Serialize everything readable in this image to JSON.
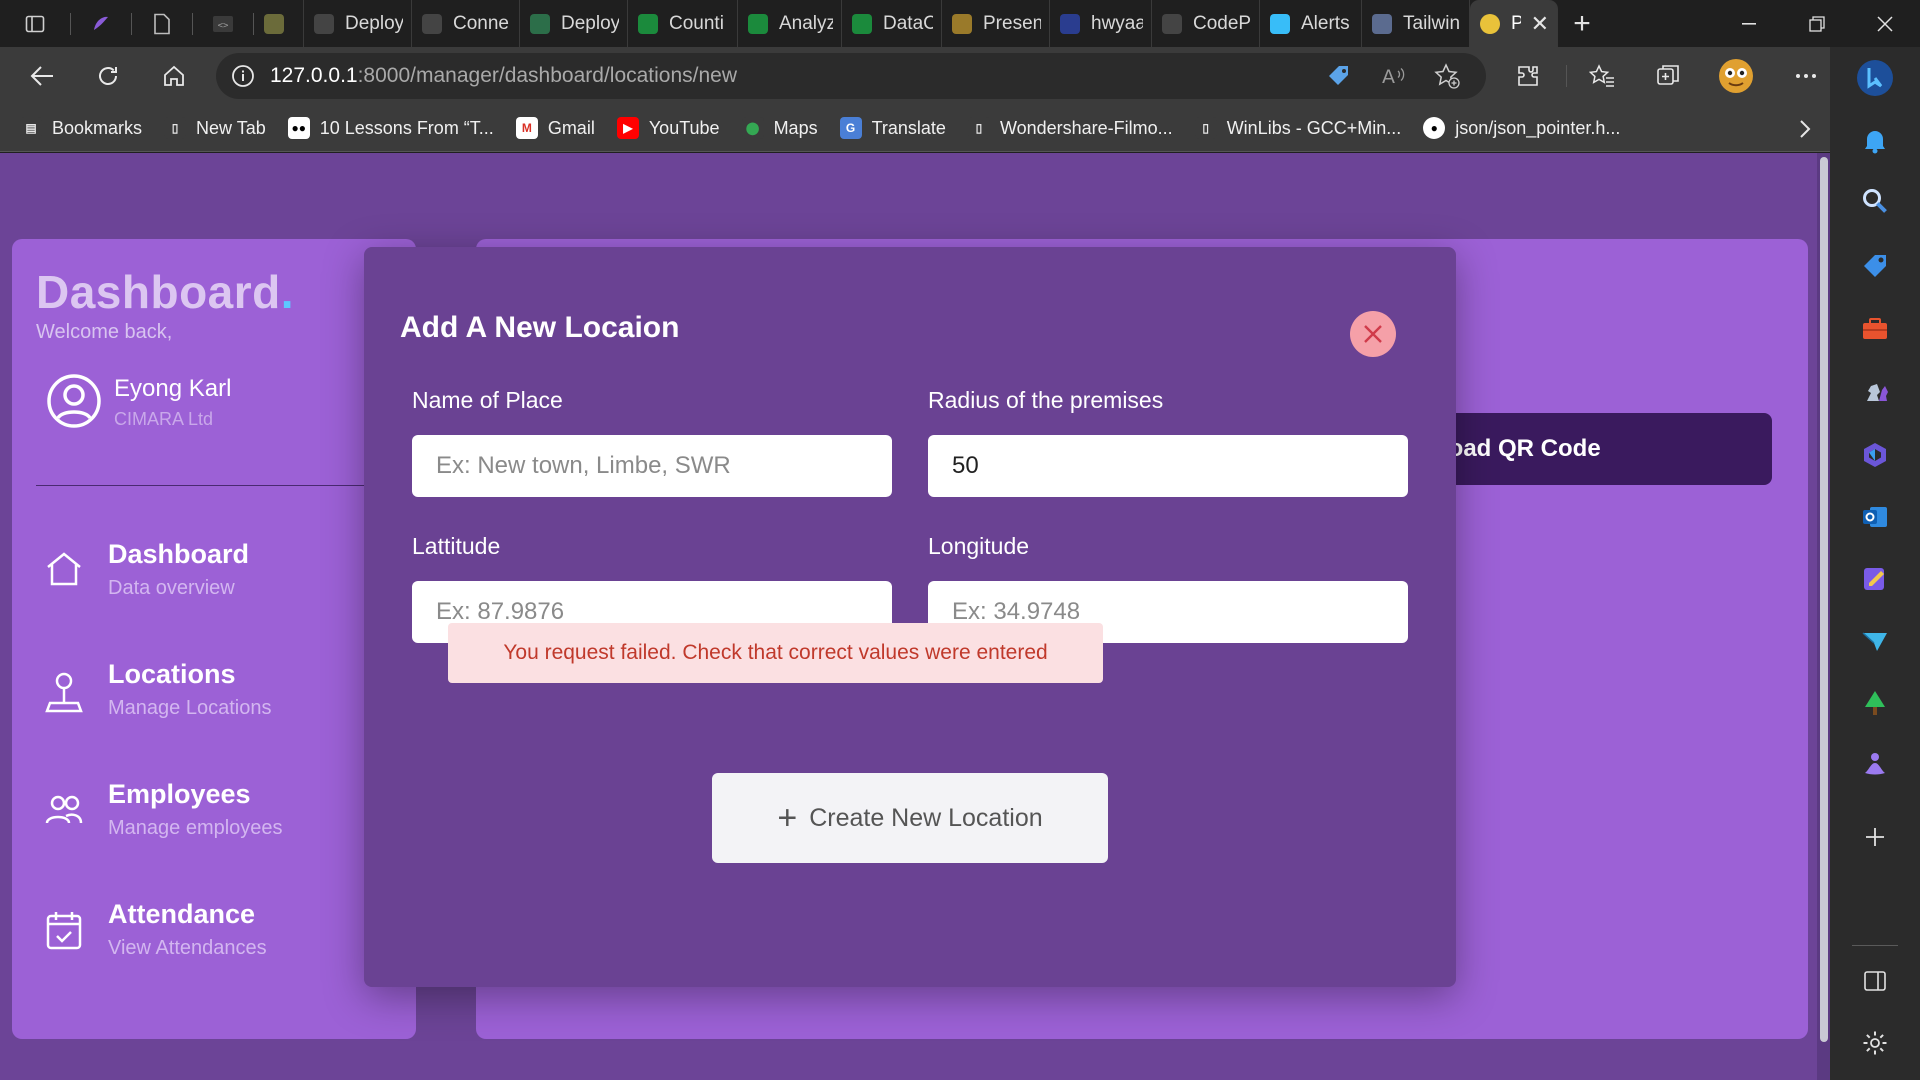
{
  "browser": {
    "tabs": [
      {
        "title": "",
        "icon": "circle-c-icon",
        "color": "#6b6b3a"
      },
      {
        "title": "Deploy",
        "icon": "render-icon",
        "color": "#444444"
      },
      {
        "title": "Conne",
        "icon": "render-icon",
        "color": "#444444"
      },
      {
        "title": "Deploy",
        "icon": "chip-icon",
        "color": "#2c6e49"
      },
      {
        "title": "Counti",
        "icon": "dataflow-icon",
        "color": "#1b8a3c"
      },
      {
        "title": "Analyz",
        "icon": "dataflow-icon",
        "color": "#1b8a3c"
      },
      {
        "title": "DataC",
        "icon": "dataflow-icon",
        "color": "#1b8a3c"
      },
      {
        "title": "Presen",
        "icon": "slides-icon",
        "color": "#9a7a2a"
      },
      {
        "title": "hwyaa",
        "icon": "cloud-icon",
        "color": "#2a3d8f"
      },
      {
        "title": "CodeP",
        "icon": "codepen-icon",
        "color": "#444444"
      },
      {
        "title": "Alerts",
        "icon": "tailwind-icon",
        "color": "#38bdf8"
      },
      {
        "title": "Tailwin",
        "icon": "t-icon",
        "color": "#5b6b8f"
      }
    ],
    "active_tab": {
      "title": "Pr",
      "icon": "coin-icon"
    },
    "url_host": "127.0.0.1",
    "url_path": ":8000/manager/dashboard/locations/new",
    "bookmarks": [
      {
        "label": "Bookmarks",
        "icon": "bookmarks-folder-icon"
      },
      {
        "label": "New Tab",
        "icon": "page-icon"
      },
      {
        "label": "10 Lessons From “T...",
        "icon": "medium-icon"
      },
      {
        "label": "Gmail",
        "icon": "gmail-icon"
      },
      {
        "label": "YouTube",
        "icon": "youtube-icon"
      },
      {
        "label": "Maps",
        "icon": "maps-icon"
      },
      {
        "label": "Translate",
        "icon": "translate-icon"
      },
      {
        "label": "Wondershare-Filmo...",
        "icon": "page-icon"
      },
      {
        "label": "WinLibs - GCC+Min...",
        "icon": "page-icon"
      },
      {
        "label": "json/json_pointer.h...",
        "icon": "github-icon"
      }
    ]
  },
  "sidebar": {
    "brand": "Dashboard",
    "brand_dot": ".",
    "welcome": "Welcome back,",
    "user_name": "Eyong Karl",
    "user_org": "CIMARA Ltd",
    "items": [
      {
        "label": "Dashboard",
        "sub": "Data overview",
        "icon": "home-icon"
      },
      {
        "label": "Locations",
        "sub": "Manage Locations",
        "icon": "location-pin-icon"
      },
      {
        "label": "Employees",
        "sub": "Manage employees",
        "icon": "users-icon"
      },
      {
        "label": "Attendance",
        "sub": "View Attendances",
        "icon": "calendar-check-icon"
      }
    ]
  },
  "main": {
    "qr_button_label": "load QR Code"
  },
  "modal": {
    "title": "Add A New Locaion",
    "fields": {
      "name": {
        "label": "Name of Place",
        "placeholder": "Ex: New town, Limbe, SWR",
        "value": ""
      },
      "radius": {
        "label": "Radius of the premises",
        "placeholder": "",
        "value": "50"
      },
      "latitude": {
        "label": "Lattitude",
        "placeholder": "Ex: 87.9876",
        "value": ""
      },
      "longitude": {
        "label": "Longitude",
        "placeholder": "Ex: 34.9748",
        "value": ""
      }
    },
    "error": "You request failed. Check that correct values were entered",
    "submit_label": "Create New Location"
  },
  "colors": {
    "page_bg": "#6c4497",
    "card_bg": "#9c61d6",
    "modal_bg": "#6a4293",
    "accent_dot": "#5cc8ff",
    "error_bg": "#fbe0e2",
    "error_text": "#c0392b",
    "close_bg": "#f5a0a8"
  }
}
